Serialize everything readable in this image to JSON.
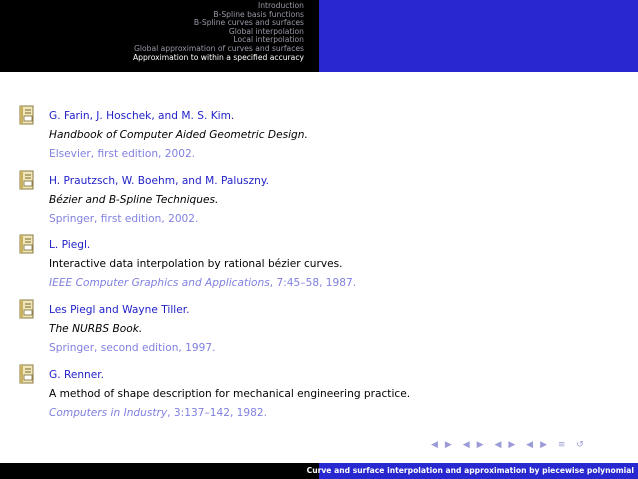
{
  "header": {
    "toc": [
      "Introduction",
      "B-Spline basis functions",
      "B-Spline curves and surfaces",
      "Global interpolation",
      "Local interpolation",
      "Global approximation of curves and surfaces",
      "Approximation to within a specified accuracy"
    ],
    "active_index": 6
  },
  "references": [
    {
      "authors": "G. Farin, J. Hoschek, and M. S. Kim.",
      "title": "Handbook of Computer Aided Geometric Design.",
      "title_italic": true,
      "pub_italic": "",
      "pub_rest": "Elsevier, first edition, 2002."
    },
    {
      "authors": "H. Prautzsch, W. Boehm, and M. Paluszny.",
      "title": "Bézier and B-Spline Techniques.",
      "title_italic": true,
      "pub_italic": "",
      "pub_rest": "Springer, first edition, 2002."
    },
    {
      "authors": "L. Piegl.",
      "title": "Interactive data interpolation by rational bézier curves.",
      "title_italic": false,
      "pub_italic": "IEEE Computer Graphics and Applications",
      "pub_rest": ", 7:45–58, 1987."
    },
    {
      "authors": "Les Piegl and Wayne Tiller.",
      "title": "The NURBS Book.",
      "title_italic": true,
      "pub_italic": "",
      "pub_rest": "Springer, second edition, 1997."
    },
    {
      "authors": "G. Renner.",
      "title": "A method of shape description for mechanical engineering practice.",
      "title_italic": false,
      "pub_italic": "Computers in Industry",
      "pub_rest": ", 3:137–142, 1982."
    }
  ],
  "footer": {
    "title": "Curve and surface interpolation and approximation by piecewise polynomial"
  },
  "colors": {
    "header_dark": "#000000",
    "header_accent": "#2828d0",
    "author": "#1e1ec8",
    "publication": "#8080e0",
    "toc_inactive": "#9a9aa8"
  },
  "icons": {
    "reference": "book-icon",
    "navigation": [
      "nav-frame-prev-icon",
      "nav-frame-next-icon",
      "nav-subsection-prev-icon",
      "nav-subsection-next-icon",
      "nav-section-prev-icon",
      "nav-section-next-icon",
      "nav-subsubsection-prev-icon",
      "nav-subsubsection-next-icon",
      "nav-align-icon",
      "nav-search-icon"
    ]
  }
}
